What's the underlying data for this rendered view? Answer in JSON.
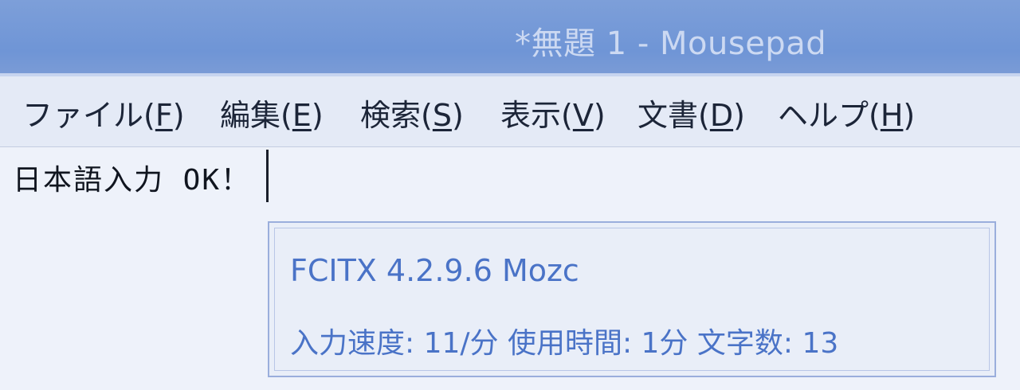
{
  "window": {
    "title": "*無題 1 - Mousepad"
  },
  "menu": {
    "items": [
      {
        "label": "ファイル(",
        "key": "F",
        "close": ")"
      },
      {
        "label": "編集(",
        "key": "E",
        "close": ")"
      },
      {
        "label": "検索(",
        "key": "S",
        "close": ")"
      },
      {
        "label": "表示(",
        "key": "V",
        "close": ")"
      },
      {
        "label": "文書(",
        "key": "D",
        "close": ")"
      },
      {
        "label": "ヘルプ(",
        "key": "H",
        "close": ")"
      }
    ]
  },
  "editor": {
    "text": "日本語入力 OK！"
  },
  "ime": {
    "name": "FCITX 4.2.9.6 Mozc",
    "stats": "入力速度: 11/分 使用時間: 1分 文字数: 13"
  }
}
